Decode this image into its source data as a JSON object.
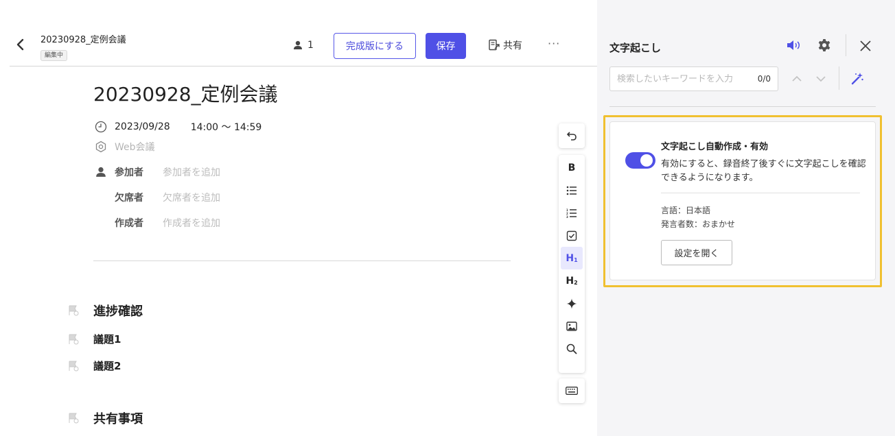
{
  "header": {
    "doc_title": "20230928_定例会議",
    "status": "編集中",
    "participant_count": "1",
    "finalize_label": "完成版にする",
    "save_label": "保存",
    "share_label": "共有",
    "more_label": "···"
  },
  "document": {
    "title": "20230928_定例会議",
    "date": "2023/09/28",
    "time": "14:00 〜 14:59",
    "location": "Web会議",
    "participants_label": "参加者",
    "participants_placeholder": "参加者を追加",
    "absent_label": "欠席者",
    "absent_placeholder": "欠席者を追加",
    "author_label": "作成者",
    "author_placeholder": "作成者を追加",
    "agenda": [
      {
        "label": "進捗確認"
      },
      {
        "label": "議題1"
      },
      {
        "label": "議題2"
      },
      {
        "label": "共有事項"
      }
    ]
  },
  "toolbar": {
    "tools": [
      "undo-icon",
      "bold-icon",
      "bullet-list-icon",
      "numbered-list-icon",
      "checkbox-icon",
      "heading1-icon",
      "heading2-icon",
      "ai-sparkle-icon",
      "image-icon",
      "search-icon",
      "keyboard-icon"
    ],
    "bold": "B",
    "h1": "H",
    "h2": "H"
  },
  "panel": {
    "title": "文字起こし",
    "search_placeholder": "検索したいキーワードを入力",
    "search_count": "0/0",
    "card": {
      "toggle_on": true,
      "title": "文字起こし自動作成・有効",
      "description": "有効にすると、録音終了後すぐに文字起こしを確認できるようになります。",
      "language": "言語：日本語",
      "speakers": "発言者数：おまかせ",
      "open_settings_label": "設定を開く"
    }
  },
  "colors": {
    "accent": "#4f50e6",
    "highlight": "#f0c030",
    "panel_bg": "#f5f5f7"
  }
}
